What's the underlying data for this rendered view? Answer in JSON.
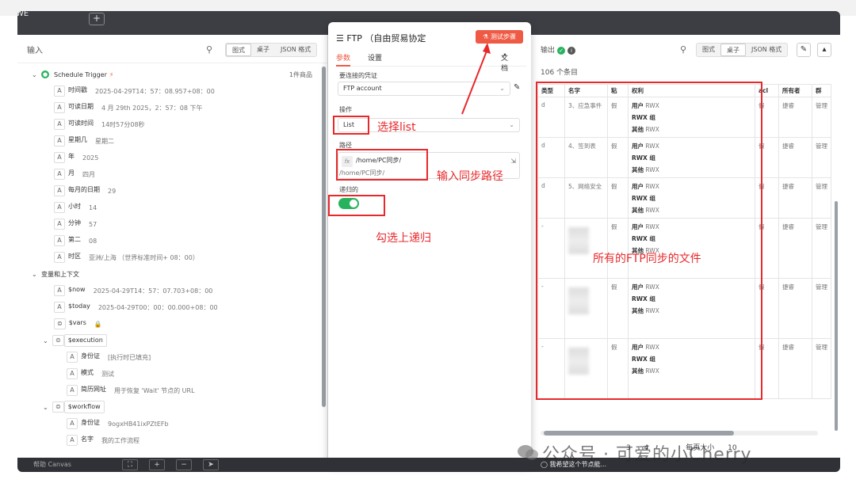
{
  "app": {
    "logo_text": "WE",
    "plus": "+"
  },
  "left_panel": {
    "title": "输入",
    "view_tabs": [
      "图式",
      "桌子",
      "JSON 格式"
    ],
    "trigger": {
      "name": "Schedule Trigger",
      "count": "1件商品"
    },
    "fields": [
      {
        "type": "A",
        "label": "时间戳",
        "value": "2025-04-29T14：57：08.957+08：00"
      },
      {
        "type": "A",
        "label": "可读日期",
        "value": "4 月 29th 2025，2：57：08 下午"
      },
      {
        "type": "A",
        "label": "可读时间",
        "value": "14时57分08秒"
      },
      {
        "type": "A",
        "label": "星期几",
        "value": "星期二"
      },
      {
        "type": "A",
        "label": "年",
        "value": "2025"
      },
      {
        "type": "A",
        "label": "月",
        "value": "四月"
      },
      {
        "type": "A",
        "label": "每月的日期",
        "value": "29"
      },
      {
        "type": "A",
        "label": "小时",
        "value": "14"
      },
      {
        "type": "A",
        "label": "分钟",
        "value": "57"
      },
      {
        "type": "A",
        "label": "第二",
        "value": "08"
      },
      {
        "type": "A",
        "label": "时区",
        "value": "亚洲/上海 （世界标准时间+ 08：00）"
      }
    ],
    "vars_section": "变量和上下文",
    "vars": [
      {
        "type": "A",
        "label": "$now",
        "value": "2025-04-29T14：57：07.703+08：00"
      },
      {
        "type": "A",
        "label": "$today",
        "value": "2025-04-29T00：00：00.000+08：00"
      },
      {
        "type": "⊜",
        "label": "$vars",
        "value": "🔒"
      }
    ],
    "execution": {
      "label": "$execution",
      "items": [
        {
          "type": "A",
          "label": "身份证",
          "value": "[执行时已填充]"
        },
        {
          "type": "A",
          "label": "模式",
          "value": "测试"
        },
        {
          "type": "A",
          "label": "简历网址",
          "value": "用于恢复 'Wait' 节点的 URL"
        }
      ]
    },
    "workflow": {
      "label": "$workflow",
      "items": [
        {
          "type": "A",
          "label": "身份证",
          "value": "9ogxHB41ixPZtEFb"
        },
        {
          "type": "A",
          "label": "名字",
          "value": "我的工作流程"
        }
      ]
    }
  },
  "dialog": {
    "title": "FTP （自由贸易协定",
    "test_button": "测试步骤",
    "tabs": [
      "参数",
      "设置"
    ],
    "docs": "文档",
    "credential_label": "要连接的凭证",
    "credential_value": "FTP account",
    "operation_label": "操作",
    "operation_value": "List",
    "path_label": "路径",
    "path_value": "/home/PC同步/",
    "path_preview": "/home/PC同步/",
    "recursive_label": "递归的",
    "recursive_on": true
  },
  "annotations": {
    "select_list": "选择list",
    "enter_path": "输入同步路径",
    "check_recursive": "勾选上递归",
    "all_files": "所有的FTP同步的文件"
  },
  "right_panel": {
    "title": "输出",
    "view_tabs": [
      "图式",
      "桌子",
      "JSON 格式"
    ],
    "item_count": "106 个条目",
    "columns": [
      "类型",
      "名字",
      "粘",
      "权利",
      "acl",
      "所有者",
      "群"
    ],
    "perm_labels": {
      "user": "用户",
      "group": "RWX 组",
      "other": "其他"
    },
    "perm_value": "RWX",
    "rows": [
      {
        "type": "d",
        "name": "3、应急事件",
        "sticky": "假",
        "acl": "假",
        "owner": "捷睿",
        "group": "管理"
      },
      {
        "type": "d",
        "name": "4、签到表",
        "sticky": "假",
        "acl": "假",
        "owner": "捷睿",
        "group": "管理"
      },
      {
        "type": "d",
        "name": "5、网络安全",
        "sticky": "假",
        "acl": "假",
        "owner": "捷睿",
        "group": "管理"
      },
      {
        "type": "-",
        "name": "",
        "sticky": "假",
        "acl": "假",
        "owner": "捷睿",
        "group": "管理"
      },
      {
        "type": "-",
        "name": "",
        "sticky": "假",
        "acl": "假",
        "owner": "捷睿",
        "group": "管理"
      },
      {
        "type": "-",
        "name": "",
        "sticky": "假",
        "acl": "假",
        "owner": "捷睿",
        "group": "管理"
      }
    ],
    "pager": {
      "pages": [
        "3",
        "4"
      ],
      "page_size_label": "每页大小",
      "page_size": "10"
    }
  },
  "bottom_bar": {
    "left_text": "帮助 Canvas",
    "hint": "我希望这个节点能..."
  },
  "watermark": "公众号 · 可爱的小Cherry"
}
